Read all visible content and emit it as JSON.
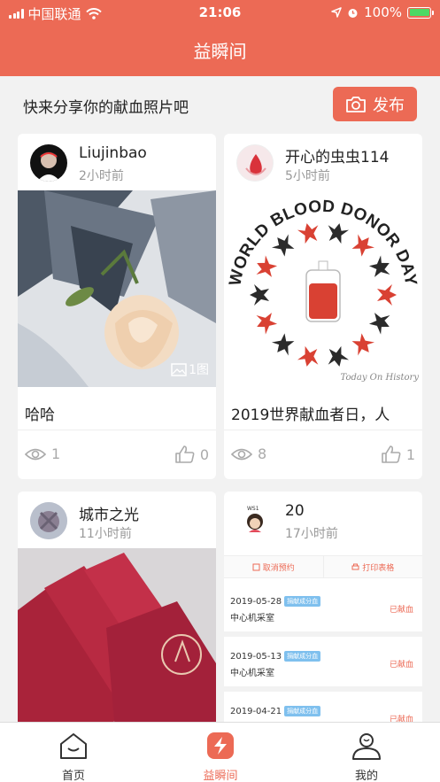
{
  "status_bar": {
    "carrier": "中国联通",
    "time": "21:06",
    "battery": "100%"
  },
  "header": {
    "title": "益瞬间"
  },
  "share_bar": {
    "prompt": "快来分享你的献血照片吧",
    "publish_label": "发布"
  },
  "posts": [
    {
      "user": "Liujinbao",
      "time": "2小时前",
      "caption": "哈哈",
      "views": "1",
      "likes": "0",
      "image_count": "1图"
    },
    {
      "user": "开心的虫虫114",
      "time": "5小时前",
      "caption": "2019世界献血者日，人",
      "views": "8",
      "likes": "1",
      "poster_text": "WORLD BLOOD DONOR DAY",
      "watermark": "Today On History"
    },
    {
      "user": "城市之光",
      "time": "11小时前"
    },
    {
      "user": "20",
      "time": "17小时前",
      "avatar_text": "WS1",
      "record_buttons": [
        "取消预约",
        "打印表格"
      ],
      "records": [
        {
          "date": "2019-05-28",
          "tag": "捐献成分血",
          "location": "中心机采室",
          "status": "已献血"
        },
        {
          "date": "2019-05-13",
          "tag": "捐献成分血",
          "location": "中心机采室",
          "status": "已献血"
        },
        {
          "date": "2019-04-21",
          "tag": "捐献成分血",
          "status": "已献血"
        }
      ]
    }
  ],
  "tabs": [
    {
      "label": "首页",
      "icon": "home-icon"
    },
    {
      "label": "益瞬间",
      "icon": "lightning-icon"
    },
    {
      "label": "我的",
      "icon": "user-icon"
    }
  ],
  "colors": {
    "accent": "#ec6a55",
    "background": "#f2f2f2"
  }
}
